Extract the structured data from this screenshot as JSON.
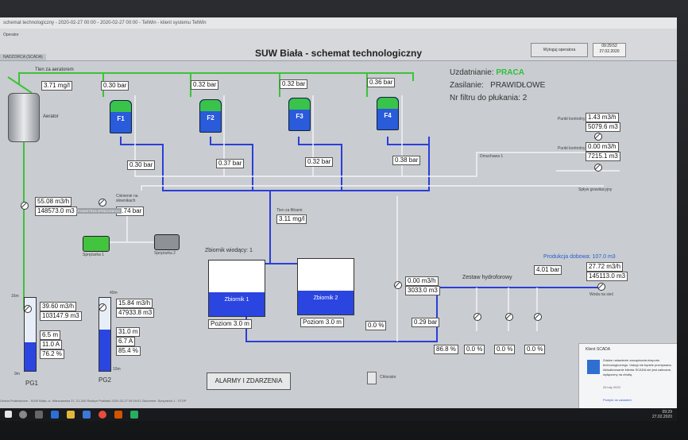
{
  "window": {
    "titlebar": "schemat technologiczny - 2020-02-27 00:00 - 2020-02-27 00:00 - TelWin - klient systemu TelWin",
    "app_label": "Operator",
    "mode": "NADZORCA (SCADA)"
  },
  "header": {
    "title": "SUW Biała - schemat technologiczny",
    "logout_label": "Wyloguj operatora",
    "time": "09:29:52",
    "date": "27.02.2020"
  },
  "status": {
    "uzdatnianie_label": "Uzdatnianie:",
    "uzdatnianie_value": "PRACA",
    "zasilanie_label": "Zasilanie:",
    "zasilanie_value": "PRAWIDŁOWE",
    "nr_filtru_label": "Nr filtru do płukania:",
    "nr_filtru_value": "2"
  },
  "aerator": {
    "label": "Aerator",
    "tlen_label": "Tlen za aeratorem",
    "tlen_value": "3.71 mg/l"
  },
  "filters": [
    {
      "name": "F1",
      "pressure_in": "0.30 bar",
      "pressure_out": "0.30 bar"
    },
    {
      "name": "F2",
      "pressure_in": "0.32 bar",
      "pressure_out": "0.37 bar"
    },
    {
      "name": "F3",
      "pressure_in": "0.32 bar",
      "pressure_out": "0.32 bar"
    },
    {
      "name": "F4",
      "pressure_in": "0.36 bar",
      "pressure_out": "0.38 bar"
    }
  ],
  "sidepanel": {
    "pkt1_label": "Punkt kontrolny 1",
    "pkt1_flow": "1.43 m3/h",
    "pkt1_total": "5079.6 m3",
    "pkt2_label": "Punkt kontrolny 2",
    "pkt2_flow": "0.00 m3/h",
    "pkt2_total": "7215.1 m3",
    "dmuchawa": "Dmuchawa 1",
    "splyw": "Spływ grawitacyjny"
  },
  "raw_water": {
    "flow": "55.08 m3/h",
    "total": "148573.0 m3",
    "cisnienie_label": "Ciśnienie na słownikach",
    "cisnienie_value": "5.74 bar",
    "tag": "POWIETRZA SPRĘŻONEGO"
  },
  "compressors": {
    "c1": "Sprężarka 1",
    "c2": "Sprężarka 2"
  },
  "filtrate": {
    "tlen_label": "Tlen za filtrami",
    "tlen_value": "3.11 mg/l"
  },
  "tanks": {
    "group_label": "Zbiornik wiodący:",
    "group_value": "1",
    "t1_name": "Zbiornik 1",
    "t1_level": "Poziom 3.0 m",
    "t2_name": "Zbiornik 2",
    "t2_level": "Poziom 3.0 m"
  },
  "wells": {
    "pg1": {
      "name": "PG1",
      "depth_top": "16m",
      "depth_bottom": "9m",
      "flow": "39.60 m3/h",
      "total": "103147.9 m3",
      "v1": "6.5 m",
      "v2": "11.0 A",
      "v3": "76.2 %"
    },
    "pg2": {
      "name": "PG2",
      "depth_top": "40m",
      "depth_bottom": "10m",
      "flow": "15.84 m3/h",
      "total": "47933.8 m3",
      "v1": "31.0 m",
      "v2": "6.7 A",
      "v3": "85.4 %"
    }
  },
  "hydrofor": {
    "label": "Zestaw hydroforowy",
    "in_flow": "0.00 m3/h",
    "in_total": "3033.0 m3",
    "pressure": "0.29 bar",
    "pct_left": "0.0 %",
    "out_pressure": "4.01 bar",
    "prod_label": "Produkcja dobowa: 107.0 m3",
    "prod_flow": "27.72 m3/h",
    "prod_total": "145113.0 m3",
    "to_network": "Woda na sieć",
    "pcts": [
      "86.8 %",
      "0.0 %",
      "0.0 %",
      "0.0 %"
    ],
    "chlorator": "Chlorator"
  },
  "alarms_button": "ALARMY I ZDARZENIA",
  "toast": {
    "header": "Klient SCADA",
    "body": "Zdalne ustawienie zarządzania eksportu technologicznego. Usługi nie będzie przerywana. Aktualizowanie klienta SCADA nie jest zalecane, wyłączony na chwilę.",
    "time": "26 luty 2020",
    "link": "Przejdź do ustawień"
  },
  "footer": "Gmina Podedwórze - SUW Biała, ul. Warszawska 37, 21-340 Radzyń Podlaski   2020-02-27 09:29:01  Zdarzenie: Sprężarka 1 - STOP",
  "taskbar": {
    "time": "09:29",
    "date": "27.02.2020"
  }
}
